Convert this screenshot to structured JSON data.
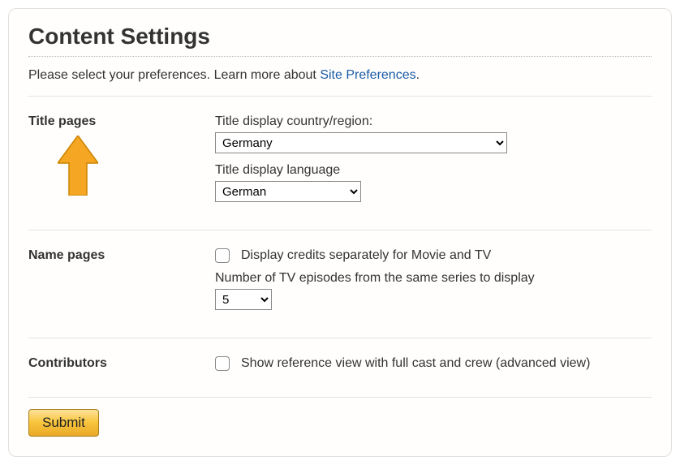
{
  "header": {
    "title": "Content Settings"
  },
  "intro": {
    "text_before": "Please select your preferences. Learn more about ",
    "link_text": "Site Preferences",
    "text_after": "."
  },
  "sections": {
    "title_pages": {
      "label": "Title pages",
      "country_label": "Title display country/region:",
      "country_value": "Germany",
      "language_label": "Title display language",
      "language_value": "German"
    },
    "name_pages": {
      "label": "Name pages",
      "credits_checkbox_label": "Display credits separately for Movie and TV",
      "credits_checked": false,
      "episodes_label": "Number of TV episodes from the same series to display",
      "episodes_value": "5"
    },
    "contributors": {
      "label": "Contributors",
      "reference_checkbox_label": "Show reference view with full cast and crew (advanced view)",
      "reference_checked": false
    }
  },
  "submit_label": "Submit"
}
